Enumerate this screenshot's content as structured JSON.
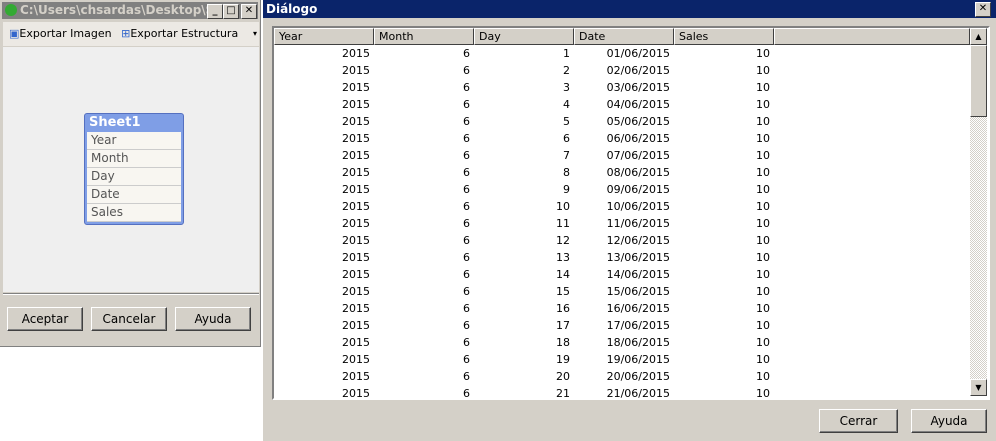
{
  "left_window": {
    "title": "C:\\Users\\chsardas\\Desktop\\S...",
    "toolbar": {
      "export_image": "Exportar Imagen",
      "export_structure": "Exportar Estructura"
    },
    "table_box": {
      "name": "Sheet1",
      "fields": [
        "Year",
        "Month",
        "Day",
        "Date",
        "Sales"
      ]
    },
    "buttons": {
      "ok": "Aceptar",
      "cancel": "Cancelar",
      "help": "Ayuda"
    }
  },
  "dialog": {
    "title": "Diálogo",
    "columns": [
      "Year",
      "Month",
      "Day",
      "Date",
      "Sales"
    ],
    "rows": [
      [
        "2015",
        "6",
        "1",
        "01/06/2015",
        "10"
      ],
      [
        "2015",
        "6",
        "2",
        "02/06/2015",
        "10"
      ],
      [
        "2015",
        "6",
        "3",
        "03/06/2015",
        "10"
      ],
      [
        "2015",
        "6",
        "4",
        "04/06/2015",
        "10"
      ],
      [
        "2015",
        "6",
        "5",
        "05/06/2015",
        "10"
      ],
      [
        "2015",
        "6",
        "6",
        "06/06/2015",
        "10"
      ],
      [
        "2015",
        "6",
        "7",
        "07/06/2015",
        "10"
      ],
      [
        "2015",
        "6",
        "8",
        "08/06/2015",
        "10"
      ],
      [
        "2015",
        "6",
        "9",
        "09/06/2015",
        "10"
      ],
      [
        "2015",
        "6",
        "10",
        "10/06/2015",
        "10"
      ],
      [
        "2015",
        "6",
        "11",
        "11/06/2015",
        "10"
      ],
      [
        "2015",
        "6",
        "12",
        "12/06/2015",
        "10"
      ],
      [
        "2015",
        "6",
        "13",
        "13/06/2015",
        "10"
      ],
      [
        "2015",
        "6",
        "14",
        "14/06/2015",
        "10"
      ],
      [
        "2015",
        "6",
        "15",
        "15/06/2015",
        "10"
      ],
      [
        "2015",
        "6",
        "16",
        "16/06/2015",
        "10"
      ],
      [
        "2015",
        "6",
        "17",
        "17/06/2015",
        "10"
      ],
      [
        "2015",
        "6",
        "18",
        "18/06/2015",
        "10"
      ],
      [
        "2015",
        "6",
        "19",
        "19/06/2015",
        "10"
      ],
      [
        "2015",
        "6",
        "20",
        "20/06/2015",
        "10"
      ],
      [
        "2015",
        "6",
        "21",
        "21/06/2015",
        "10"
      ]
    ],
    "buttons": {
      "close": "Cerrar",
      "help": "Ayuda"
    }
  }
}
